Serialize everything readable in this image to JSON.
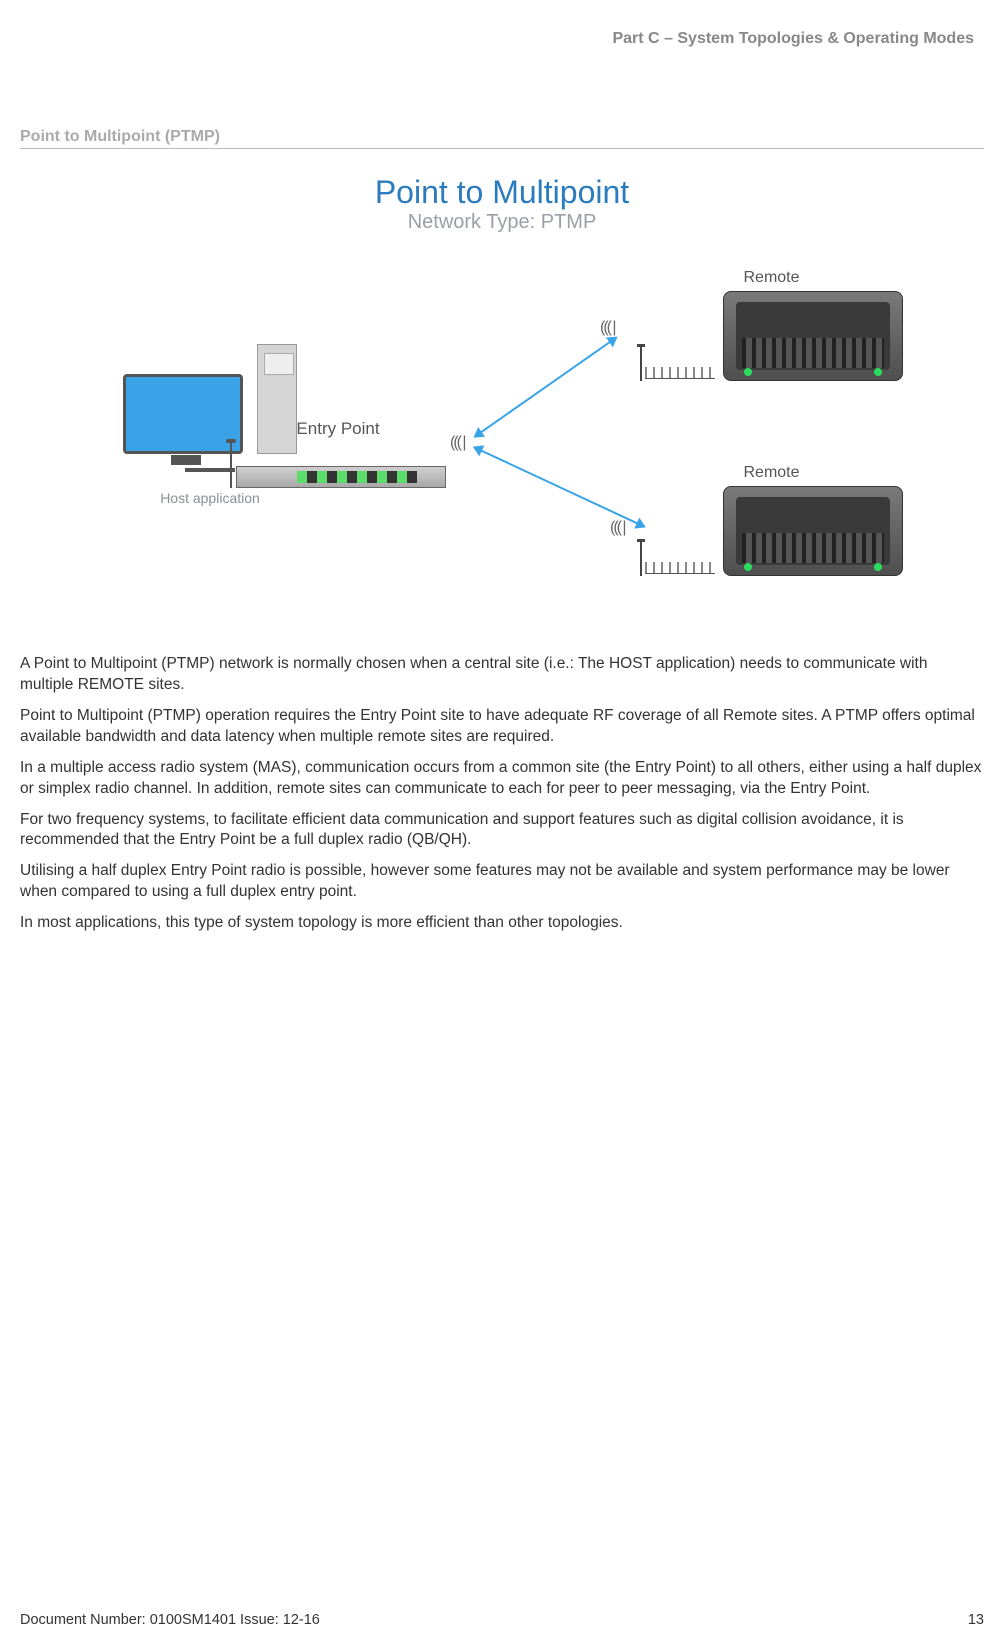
{
  "header": {
    "part_title": "Part C – System Topologies & Operating Modes"
  },
  "section": {
    "heading": "Point to Multipoint (PTMP)"
  },
  "diagram": {
    "title": "Point to Multipoint",
    "subtitle": "Network Type: PTMP",
    "host_label": "Host application",
    "entry_label": "Entry Point",
    "remote1_label": "Remote",
    "remote2_label": "Remote"
  },
  "body": {
    "p1": "A Point to Multipoint (PTMP) network is normally chosen when a central site (i.e.: The HOST application) needs to communicate with multiple REMOTE sites.",
    "p2": "Point to Multipoint (PTMP) operation requires the Entry Point site to have adequate RF coverage of all Remote sites. A PTMP offers optimal available bandwidth and data latency when multiple remote sites are required.",
    "p3": "In a multiple access radio system (MAS), communication occurs from a common site (the Entry Point) to all others, either using a half duplex or simplex radio channel. In addition, remote sites can communicate to each for peer to peer messaging, via the Entry Point.",
    "p4": "For two frequency systems, to facilitate efficient data communication and support features such as digital collision avoidance, it is recommended that the Entry Point be a full duplex radio (QB/QH).",
    "p5": "Utilising a half duplex Entry Point radio is possible, however some features may not be available and system performance may be lower when compared to using a full duplex entry point.",
    "p6": "In most applications, this type of system topology is more efficient than other topologies."
  },
  "footer": {
    "doc": "Document Number: 0100SM1401   Issue: 12-16",
    "page": "13"
  }
}
